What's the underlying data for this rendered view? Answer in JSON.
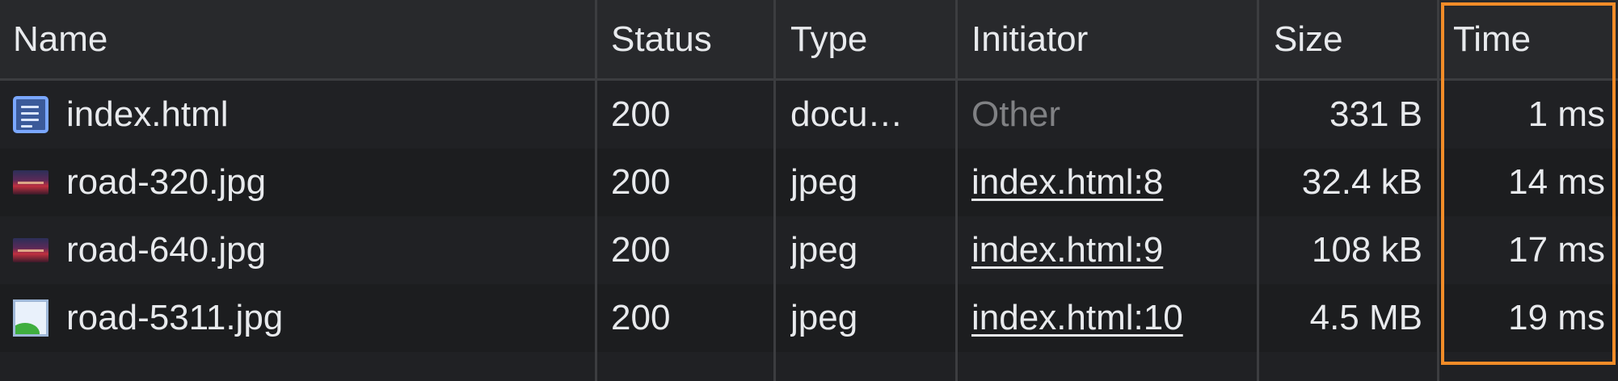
{
  "columns": {
    "name": "Name",
    "status": "Status",
    "type": "Type",
    "initiator": "Initiator",
    "size": "Size",
    "time": "Time"
  },
  "rows": [
    {
      "icon": "document-icon",
      "name": "index.html",
      "status": "200",
      "type": "docu…",
      "initiator": "Other",
      "initiator_is_link": false,
      "size": "331 B",
      "time": "1 ms"
    },
    {
      "icon": "image-thumbnail-icon",
      "name": "road-320.jpg",
      "status": "200",
      "type": "jpeg",
      "initiator": "index.html:8",
      "initiator_is_link": true,
      "size": "32.4 kB",
      "time": "14 ms"
    },
    {
      "icon": "image-thumbnail-icon",
      "name": "road-640.jpg",
      "status": "200",
      "type": "jpeg",
      "initiator": "index.html:9",
      "initiator_is_link": true,
      "size": "108 kB",
      "time": "17 ms"
    },
    {
      "icon": "image-placeholder-icon",
      "name": "road-5311.jpg",
      "status": "200",
      "type": "jpeg",
      "initiator": "index.html:10",
      "initiator_is_link": true,
      "size": "4.5 MB",
      "time": "19 ms"
    }
  ],
  "colors": {
    "background": "#202124",
    "alt_row": "#1c1d1f",
    "grid_line": "#3c3d40",
    "text": "#e8eaed",
    "muted_text": "#808184",
    "highlight": "#f28c28"
  }
}
